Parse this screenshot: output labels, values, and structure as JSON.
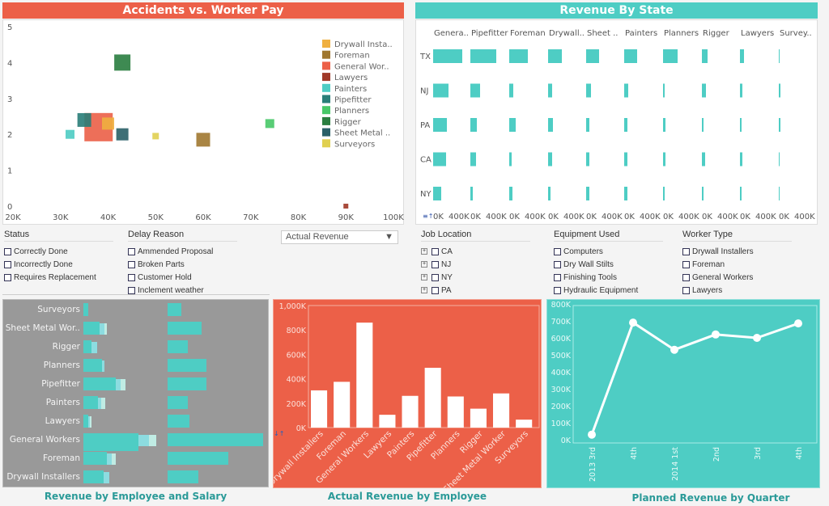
{
  "scatter": {
    "title": "Accidents vs. Worker Pay",
    "header_color": "#ec6048",
    "chart_data": {
      "type": "scatter",
      "xlim": [
        20,
        100
      ],
      "ylim": [
        0,
        5
      ],
      "x_ticks": [
        "20K",
        "30K",
        "40K",
        "50K",
        "60K",
        "70K",
        "80K",
        "90K",
        "100K"
      ],
      "y_ticks": [
        "0",
        "1",
        "2",
        "3",
        "4",
        "5"
      ],
      "legend_placement": "right",
      "series": [
        {
          "name": "Drywall Insta..",
          "color": "#f0b040",
          "x": 40,
          "y": 2.3,
          "magnitude": 14
        },
        {
          "name": "Foreman",
          "color": "#a07830",
          "x": 60,
          "y": 1.85,
          "magnitude": 16
        },
        {
          "name": "General Wor..",
          "color": "#ec6048",
          "x": 38,
          "y": 2.2,
          "magnitude": 34
        },
        {
          "name": "Lawyers",
          "color": "#a03828",
          "x": 90,
          "y": 0,
          "magnitude": 5
        },
        {
          "name": "Painters",
          "color": "#4ecdc4",
          "x": 32,
          "y": 2,
          "magnitude": 10
        },
        {
          "name": "Pipefitter",
          "color": "#2a7e78",
          "x": 35,
          "y": 2.4,
          "magnitude": 16
        },
        {
          "name": "Planners",
          "color": "#48c868",
          "x": 74,
          "y": 2.3,
          "magnitude": 10
        },
        {
          "name": "Rigger",
          "color": "#2a7e40",
          "x": 43,
          "y": 4,
          "magnitude": 19
        },
        {
          "name": "Sheet Metal ..",
          "color": "#2a6068",
          "x": 43,
          "y": 2,
          "magnitude": 14
        },
        {
          "name": "Surveyors",
          "color": "#e0d050",
          "x": 50,
          "y": 1.95,
          "magnitude": 7
        }
      ]
    }
  },
  "state": {
    "title": "Revenue By State",
    "header_color": "#4ecdc4",
    "chart_data": {
      "type": "bar",
      "orientation": "horizontal",
      "xlim": [
        0,
        470
      ],
      "tick_labels": [
        "0K",
        "400K"
      ],
      "columns": [
        "Genera..",
        "Pipefitter",
        "Foreman",
        "Drywall..",
        "Sheet ..",
        "Painters",
        "Planners",
        "Rigger",
        "Lawyers",
        "Survey.."
      ],
      "rows": [
        "TX",
        "NJ",
        "PA",
        "CA",
        "NY"
      ],
      "values": [
        [
          360,
          320,
          230,
          170,
          160,
          160,
          180,
          70,
          50,
          10
        ],
        [
          190,
          120,
          50,
          50,
          60,
          50,
          20,
          50,
          30,
          20
        ],
        [
          170,
          80,
          80,
          60,
          40,
          40,
          30,
          20,
          20,
          20
        ],
        [
          160,
          70,
          30,
          50,
          40,
          40,
          30,
          40,
          30,
          10
        ],
        [
          100,
          30,
          40,
          30,
          40,
          40,
          20,
          20,
          20,
          10
        ]
      ]
    }
  },
  "filters": {
    "status": {
      "label": "Status",
      "items": [
        "Correctly Done",
        "Incorrectly Done",
        "Requires Replacement"
      ]
    },
    "delay": {
      "label": "Delay Reason",
      "items": [
        "Ammended Proposal",
        "Broken Parts",
        "Customer Hold",
        "Inclement weather"
      ]
    },
    "measure_select": "Actual Revenue",
    "location": {
      "label": "Job Location",
      "items": [
        "CA",
        "NJ",
        "NY",
        "PA"
      ]
    },
    "equipment": {
      "label": "Equipment Used",
      "items": [
        "Computers",
        "Dry Wall Stilts",
        "Finishing Tools",
        "Hydraulic Equipment"
      ]
    },
    "worker": {
      "label": "Worker Type",
      "items": [
        "Drywall Installers",
        "Foreman",
        "General Workers",
        "Lawyers"
      ]
    }
  },
  "emp_salary": {
    "title": "Revenue by Employee and Salary",
    "bg": "#999999",
    "chart_data": {
      "type": "bar",
      "orientation": "horizontal",
      "categories": [
        "Surveyors",
        "Sheet Metal Wor..",
        "Rigger",
        "Planners",
        "Pipefitter",
        "Painters",
        "Lawyers",
        "General Workers",
        "Foreman",
        "Drywall Installers"
      ],
      "revenue_segments": [
        [
          6,
          0,
          0
        ],
        [
          20,
          6,
          3
        ],
        [
          10,
          7,
          0
        ],
        [
          23,
          3,
          0
        ],
        [
          40,
          6,
          6
        ],
        [
          18,
          4,
          5
        ],
        [
          6,
          2,
          2
        ],
        [
          68,
          13,
          9
        ],
        [
          29,
          6,
          5
        ],
        [
          25,
          7,
          0
        ]
      ],
      "salary": [
        17,
        42,
        25,
        48,
        48,
        25,
        27,
        118,
        75,
        38
      ]
    }
  },
  "actual": {
    "title": "Actual Revenue by Employee",
    "bg": "#ec6048",
    "chart_data": {
      "type": "bar",
      "ylim": [
        0,
        1000
      ],
      "y_ticks": [
        "0K",
        "200K",
        "400K",
        "600K",
        "800K",
        "1,000K"
      ],
      "categories": [
        "Drywall Installers",
        "Foreman",
        "General Workers",
        "Lawyers",
        "Painters",
        "Pipefitter",
        "Planners",
        "Rigger",
        "Sheet Metal Worker",
        "Surveyors"
      ],
      "values": [
        305,
        375,
        860,
        105,
        260,
        490,
        255,
        155,
        280,
        65
      ]
    }
  },
  "planned": {
    "title": "Planned Revenue by Quarter",
    "bg": "#4ecdc4",
    "chart_data": {
      "type": "line",
      "ylim": [
        0,
        800
      ],
      "y_ticks": [
        "0K",
        "100K",
        "200K",
        "300K",
        "400K",
        "500K",
        "600K",
        "700K",
        "800K"
      ],
      "categories": [
        "2013 3rd",
        "4th",
        "2014 1st",
        "2nd",
        "3rd",
        "4th"
      ],
      "values": [
        30,
        690,
        530,
        620,
        600,
        685
      ]
    }
  }
}
